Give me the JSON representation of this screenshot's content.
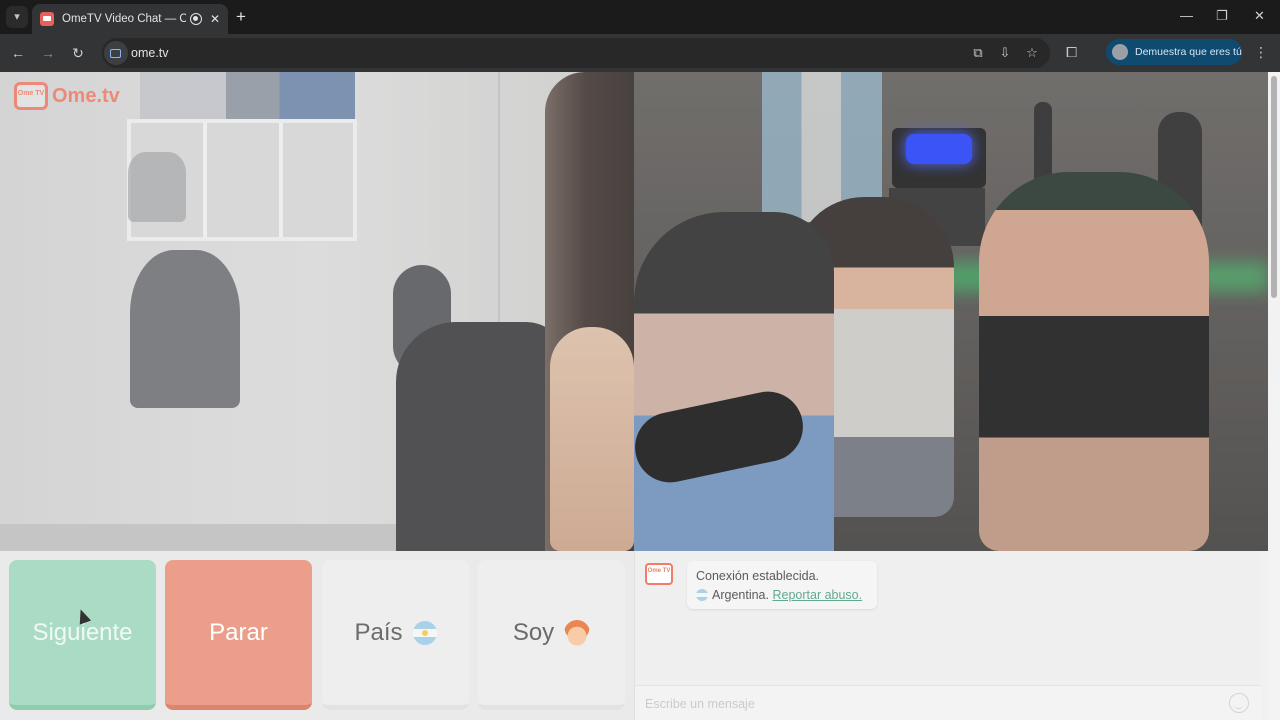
{
  "browser": {
    "tab": {
      "title": "OmeTV Video Chat — Ome"
    },
    "url": "ome.tv",
    "profile_label": "Demuestra que eres tú",
    "icons": {
      "tab_search": "chevron-down-icon",
      "new_tab": "plus-icon",
      "back": "arrow-left-icon",
      "forward": "arrow-right-icon",
      "reload": "reload-icon",
      "translate": "translate-icon",
      "install": "install-icon",
      "bookmark": "star-icon",
      "extensions": "puzzle-icon",
      "menu": "kebab-icon"
    }
  },
  "page": {
    "logo_text": "Ome.tv",
    "logo_tv_text": "Ome TV",
    "buttons": {
      "next": "Siguiente",
      "stop": "Parar",
      "country": "País",
      "gender": "Soy"
    },
    "chat": {
      "logo_text": "Ome TV",
      "status": "Conexión establecida.",
      "country": "Argentina.",
      "report_link": "Reportar abuso.",
      "input_placeholder": "Escribe un mensaje"
    },
    "colors": {
      "next_button": "#9fd8be",
      "stop_button": "#e9927a",
      "brand": "#f06a52"
    }
  }
}
